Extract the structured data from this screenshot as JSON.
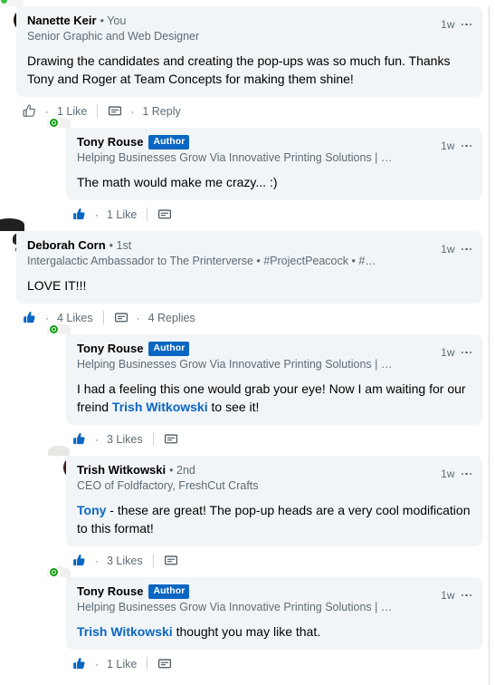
{
  "theme": {
    "link_color": "#0a66c2",
    "bubble_bg": "#f1f5f8",
    "muted_text": "#5e6b74",
    "badge_bg": "#0a66c2",
    "presence_green": "#3ec13e",
    "open_to_green": "#0f9d0f"
  },
  "comments": [
    {
      "id": "c1",
      "level": 0,
      "avatar": "nanette-keir-avatar",
      "avatar_style": "av-nanette",
      "presence": "online-dot",
      "author": "Nanette Keir",
      "degree": "• You",
      "badge": "",
      "headline": "Senior Graphic and Web Designer",
      "timestamp": "1w",
      "text_parts": [
        {
          "type": "text",
          "value": "Drawing the candidates and creating the pop-ups was so much fun. Thanks Tony and Roger at Team Concepts for making them shine!"
        }
      ],
      "like_icon": "thumbs-up-outline-icon",
      "like_label": "1 Like",
      "reply_icon": "comment-bubble-icon",
      "reply_label": "1 Reply"
    },
    {
      "id": "c2",
      "level": 1,
      "avatar": "tony-rouse-avatar",
      "avatar_style": "av-tony",
      "presence": "open-to-work-ring",
      "author": "Tony Rouse",
      "degree": "",
      "badge": "Author",
      "headline": "Helping Businesses Grow Via Innovative Printing Solutions | …",
      "timestamp": "1w",
      "text_parts": [
        {
          "type": "text",
          "value": "The math would make me crazy... :)"
        }
      ],
      "like_icon": "thumbs-up-filled-icon",
      "like_label": "1 Like",
      "reply_icon": "comment-bubble-icon",
      "reply_label": ""
    },
    {
      "id": "c3",
      "level": 0,
      "avatar": "deborah-corn-avatar",
      "avatar_style": "av-deborah",
      "presence": "none",
      "author": "Deborah Corn",
      "degree": "• 1st",
      "badge": "",
      "headline": "Intergalactic Ambassador to The Printerverse • #ProjectPeacock • #…",
      "timestamp": "1w",
      "text_parts": [
        {
          "type": "text",
          "value": "LOVE IT!!!"
        }
      ],
      "like_icon": "thumbs-up-filled-icon",
      "like_label": "4 Likes",
      "reply_icon": "comment-bubble-icon",
      "reply_label": "4 Replies"
    },
    {
      "id": "c4",
      "level": 1,
      "avatar": "tony-rouse-avatar",
      "avatar_style": "av-tony",
      "presence": "open-to-work-ring",
      "author": "Tony Rouse",
      "degree": "",
      "badge": "Author",
      "headline": "Helping Businesses Grow Via Innovative Printing Solutions | …",
      "timestamp": "1w",
      "text_parts": [
        {
          "type": "text",
          "value": "I had a feeling this one would grab your eye! Now I am waiting for our freind "
        },
        {
          "type": "mention",
          "value": "Trish Witkowski"
        },
        {
          "type": "text",
          "value": " to see it!"
        }
      ],
      "like_icon": "thumbs-up-filled-icon",
      "like_label": "3 Likes",
      "reply_icon": "comment-bubble-icon",
      "reply_label": ""
    },
    {
      "id": "c5",
      "level": 1,
      "avatar": "trish-witkowski-avatar",
      "avatar_style": "av-trish",
      "presence": "none",
      "author": "Trish Witkowski",
      "degree": "• 2nd",
      "badge": "",
      "headline": "CEO of Foldfactory, FreshCut Crafts",
      "timestamp": "1w",
      "text_parts": [
        {
          "type": "mention",
          "value": "Tony"
        },
        {
          "type": "text",
          "value": " - these are great! The pop-up heads are a very cool modification to this format!"
        }
      ],
      "like_icon": "thumbs-up-filled-icon",
      "like_label": "3 Likes",
      "reply_icon": "comment-bubble-icon",
      "reply_label": ""
    },
    {
      "id": "c6",
      "level": 1,
      "avatar": "tony-rouse-avatar",
      "avatar_style": "av-tony",
      "presence": "open-to-work-ring",
      "author": "Tony Rouse",
      "degree": "",
      "badge": "Author",
      "headline": "Helping Businesses Grow Via Innovative Printing Solutions | …",
      "timestamp": "1w",
      "text_parts": [
        {
          "type": "mention",
          "value": "Trish Witkowski"
        },
        {
          "type": "text",
          "value": " thought you may like that."
        }
      ],
      "like_icon": "thumbs-up-filled-icon",
      "like_label": "1 Like",
      "reply_icon": "comment-bubble-icon",
      "reply_label": ""
    }
  ]
}
